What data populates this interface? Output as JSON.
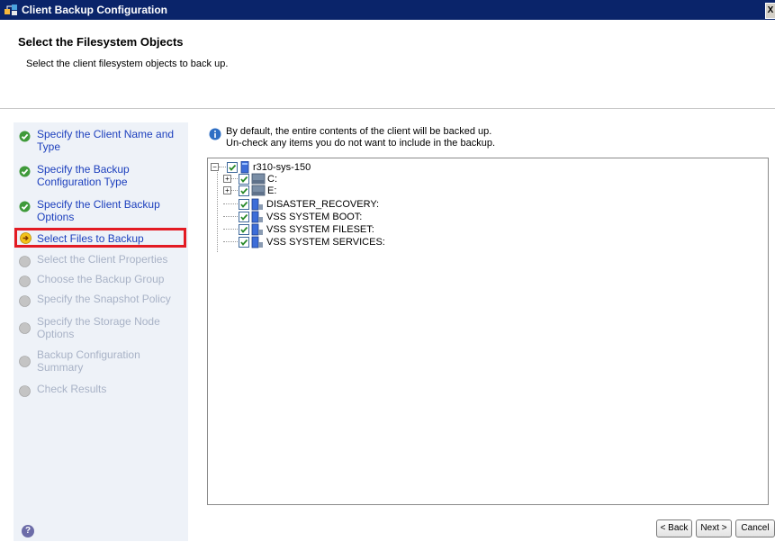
{
  "window": {
    "title": "Client Backup Configuration",
    "close_glyph": "X"
  },
  "header": {
    "title": "Select the Filesystem Objects",
    "subtitle": "Select the client filesystem objects to back up."
  },
  "steps": [
    {
      "label": "Specify the Client Name and Type",
      "state": "done"
    },
    {
      "label": "Specify the Backup Configuration Type",
      "state": "done"
    },
    {
      "label": "Specify the Client Backup Options",
      "state": "done"
    },
    {
      "label": "Select Files to Backup",
      "state": "current"
    },
    {
      "label": "Select the Client Properties",
      "state": "pending"
    },
    {
      "label": "Choose the Backup Group",
      "state": "pending"
    },
    {
      "label": "Specify the Snapshot Policy",
      "state": "pending"
    },
    {
      "label": "Specify the Storage Node Options",
      "state": "pending"
    },
    {
      "label": "Backup Configuration Summary",
      "state": "pending"
    },
    {
      "label": "Check Results",
      "state": "pending"
    }
  ],
  "info": {
    "line1": "By default, the entire contents of the client will be backed up.",
    "line2": "Un-check any items you do not want to include in the backup."
  },
  "tree": {
    "root": {
      "label": "r310-sys-150",
      "checked": true,
      "expanded": true,
      "icon": "computer-icon"
    },
    "children": [
      {
        "label": "C:",
        "checked": true,
        "expandable": true,
        "icon": "drive-icon"
      },
      {
        "label": "E:",
        "checked": true,
        "expandable": true,
        "icon": "drive-icon"
      },
      {
        "label": "DISASTER_RECOVERY:",
        "checked": true,
        "expandable": false,
        "icon": "vss-icon"
      },
      {
        "label": "VSS SYSTEM BOOT:",
        "checked": true,
        "expandable": false,
        "icon": "vss-icon"
      },
      {
        "label": "VSS SYSTEM FILESET:",
        "checked": true,
        "expandable": false,
        "icon": "vss-icon"
      },
      {
        "label": "VSS SYSTEM SERVICES:",
        "checked": true,
        "expandable": false,
        "icon": "vss-icon"
      }
    ]
  },
  "footer": {
    "help_glyph": "?",
    "back_label": "< Back",
    "next_label": "Next >",
    "cancel_label": "Cancel"
  },
  "colors": {
    "title_bar": "#0a246a",
    "step_active": "#1c3fbd",
    "step_pending": "#a8b2c6",
    "highlight": "#e31b23"
  }
}
